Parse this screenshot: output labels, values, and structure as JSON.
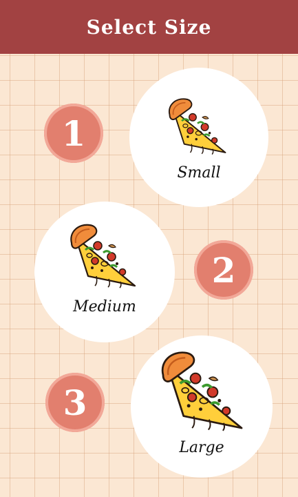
{
  "header": {
    "title": "Select Size"
  },
  "sizes": [
    {
      "number": "1",
      "label": "Small"
    },
    {
      "number": "2",
      "label": "Medium"
    },
    {
      "number": "3",
      "label": "Large"
    }
  ],
  "colors": {
    "header_bg": "#a24242",
    "badge_fill": "#e27f6e",
    "background": "#fbe7d3",
    "card": "#ffffff"
  },
  "icons": {
    "pizza": "pizza-slice-icon"
  }
}
